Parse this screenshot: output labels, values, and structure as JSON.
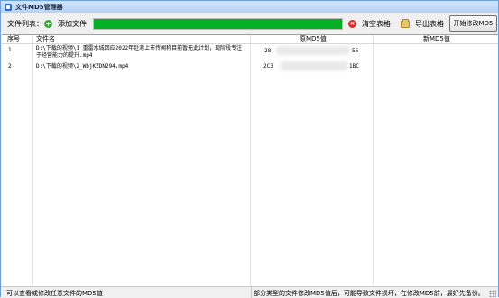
{
  "window": {
    "title": "文件MD5管理器"
  },
  "toolbar": {
    "file_list_label": "文件列表：",
    "add_file_label": "添加文件",
    "progress_fraction": 1.0,
    "progress_color": "#06b025",
    "clear_table_label": "清空表格",
    "export_table_label": "导出表格",
    "start_label": "开始修改MD5"
  },
  "grid": {
    "columns": [
      "序号",
      "文件名",
      "原MD5值",
      "新MD5值"
    ],
    "rows": [
      {
        "index": "1",
        "filename": "D:\\下载的视频\\1_重雷水城回应2022年赴港上市传闻称目前暂无此计划，现阶段专注于经营能力的提升.mp4",
        "orig_md5_start": "28",
        "orig_md5_end": "56",
        "new_md5": ""
      },
      {
        "index": "2",
        "filename": "D:\\下载的视频\\2_WbjKZDN294.mp4",
        "orig_md5_start": "2C3",
        "orig_md5_end": "1BC",
        "new_md5": ""
      }
    ]
  },
  "status": {
    "left": "可以查看或修改任意文件的MD5值",
    "right": "部分类型的文件修改MD5值后，可能导致文件损坏，在修改MD5前，最好先备份。"
  },
  "icons": {
    "app": "app-icon",
    "add": "plus-circle-icon",
    "clear": "clear-circle-icon",
    "export": "folder-export-icon",
    "grip": "resize-grip-icon"
  }
}
